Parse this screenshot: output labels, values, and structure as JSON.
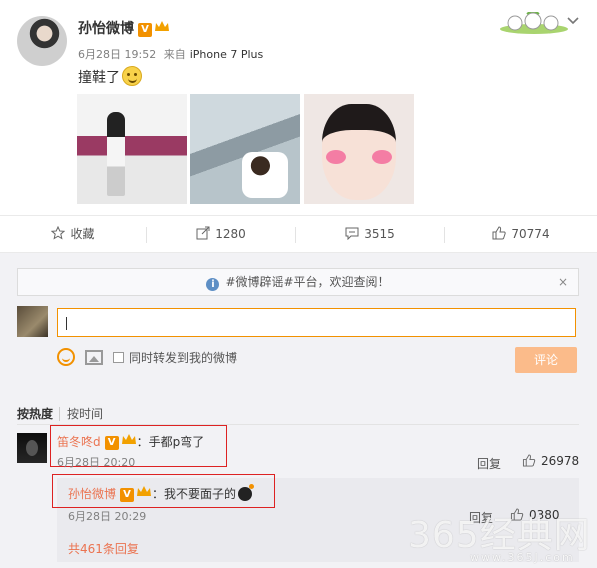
{
  "post": {
    "author": "孙怡微博",
    "v_badge": "V",
    "date": "6月28日 19:52",
    "source_prefix": "来自",
    "source": "iPhone 7 Plus",
    "text": "撞鞋了"
  },
  "actions": {
    "favorite": "收藏",
    "repost_count": "1280",
    "comment_count": "3515",
    "like_count": "70774"
  },
  "notice": {
    "icon": "i",
    "text": "#微博辟谣#平台，欢迎查阅！",
    "close": "×"
  },
  "composer": {
    "forward_label": "同时转发到我的微博",
    "submit_label": "评论"
  },
  "sort": {
    "by_hot": "按热度",
    "by_time": "按时间"
  },
  "comments": [
    {
      "user": "笛冬咚d",
      "v_badge": "V",
      "text": "：手都p弯了",
      "time": "6月28日 20:20",
      "reply_label": "回复",
      "likes": "26978"
    }
  ],
  "reply": {
    "user": "孙怡微博",
    "v_badge": "V",
    "text": "：我不要面子的",
    "time": "6月28日 20:29",
    "reply_label": "回复",
    "likes": "0380",
    "total_replies": "共461条回复"
  },
  "watermark": {
    "text": "365经典网",
    "url": "www.365J.com"
  },
  "colors": {
    "accent": "#f29100",
    "username": "#eb7350",
    "highlight_box": "#dd2222"
  }
}
